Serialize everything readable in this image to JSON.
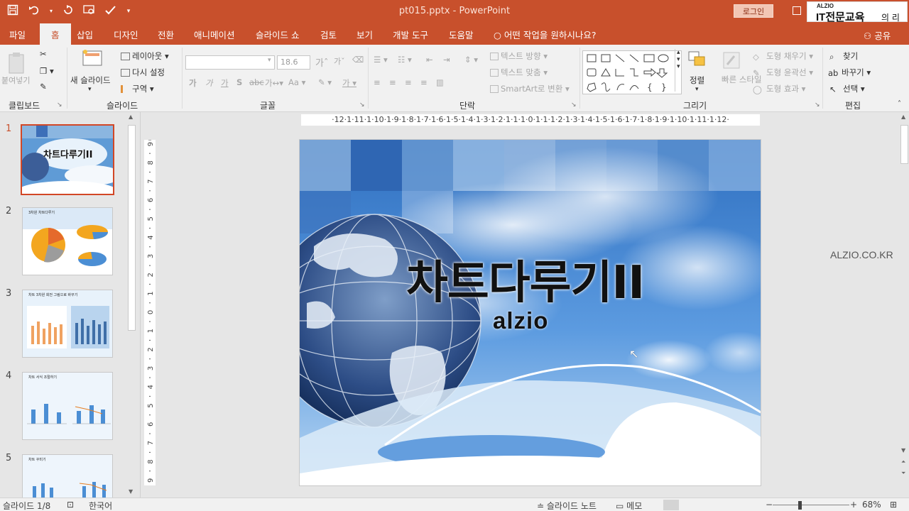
{
  "app": {
    "document_title": "pt015.pptx - PowerPoint",
    "login_label": "로그인",
    "brand_small": "ALZIO",
    "brand_main": "IT전문교육",
    "brand_sub": "의 리더!",
    "share_label": "공유",
    "accent_color": "#c8502c"
  },
  "tabs": [
    {
      "label": "파일"
    },
    {
      "label": "홈",
      "active": true
    },
    {
      "label": "삽입"
    },
    {
      "label": "디자인"
    },
    {
      "label": "전환"
    },
    {
      "label": "애니메이션"
    },
    {
      "label": "슬라이드 쇼"
    },
    {
      "label": "검토"
    },
    {
      "label": "보기"
    },
    {
      "label": "개발 도구"
    },
    {
      "label": "도움말"
    },
    {
      "label": "어떤 작업을 원하시나요?"
    }
  ],
  "ribbon": {
    "clipboard": {
      "group": "클립보드",
      "paste": "붙여넣기"
    },
    "slides": {
      "group": "슬라이드",
      "new_slide": "새 슬라이드",
      "layout": "레이아웃",
      "reset": "다시 설정",
      "section": "구역"
    },
    "font": {
      "group": "글꼴",
      "font_name": "",
      "font_size": "18.6"
    },
    "paragraph": {
      "group": "단락",
      "text_direction": "텍스트 방향",
      "align_text": "텍스트 맞춤",
      "smartart": "SmartArt로 변환"
    },
    "drawing": {
      "group": "그리기",
      "arrange": "정렬",
      "quick_styles": "빠른 스타일",
      "shape_fill": "도형 채우기",
      "shape_outline": "도형 윤곽선",
      "shape_effects": "도형 효과"
    },
    "editing": {
      "group": "편집",
      "find": "찾기",
      "replace": "바꾸기",
      "select": "선택"
    }
  },
  "thumbnails": [
    {
      "number": "1",
      "title": "차트다루기II",
      "active": true
    },
    {
      "number": "2",
      "title": "3차원 차트다루기"
    },
    {
      "number": "3",
      "title": "차트 3차원 회전 그림으로 바꾸기"
    },
    {
      "number": "4",
      "title": "차트 서식 조절하기"
    },
    {
      "number": "5",
      "title": "차트 꾸미기"
    }
  ],
  "ruler": {
    "horizontal": "·12·1·11·1·10·1·9·1·8·1·7·1·6·1·5·1·4·1·3·1·2·1·1·1·0·1·1·1·2·1·3·1·4·1·5·1·6·1·7·1·8·1·9·1·10·1·11·1·12·"
  },
  "slide": {
    "title": "차트다루기II",
    "subtitle": "alzio"
  },
  "watermark": "ALZIO.CO.KR",
  "status": {
    "slide_count": "슬라이드 1/8",
    "language": "한국어",
    "notes": "슬라이드 노트",
    "comments": "메모",
    "zoom": "68%"
  }
}
